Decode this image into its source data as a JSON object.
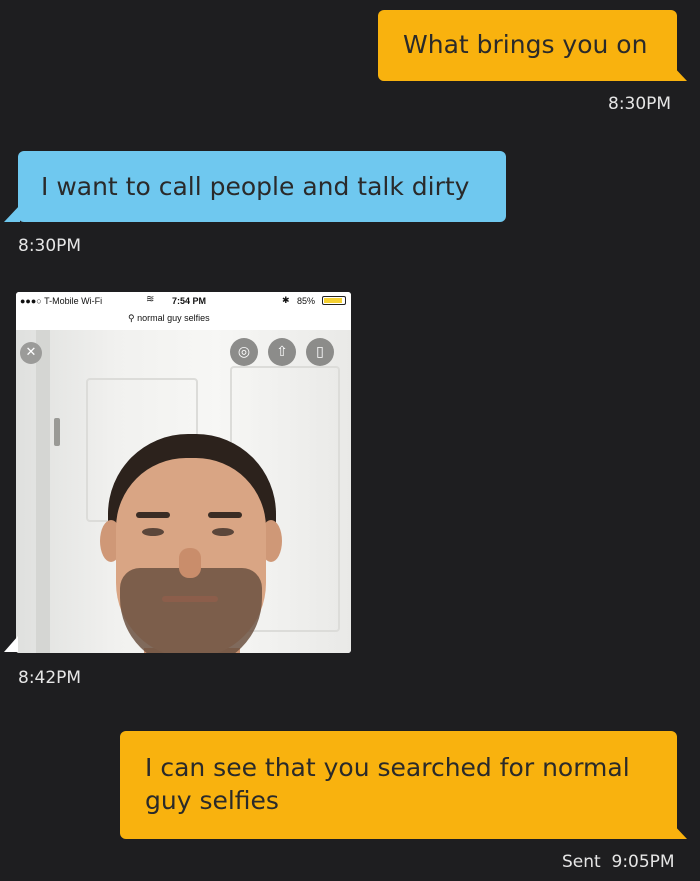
{
  "messages": [
    {
      "direction": "out",
      "text": "What brings you on",
      "time": "8:30PM"
    },
    {
      "direction": "in",
      "text": "I want to call people and talk dirty",
      "time": "8:30PM"
    },
    {
      "direction": "in",
      "type": "image",
      "time": "8:42PM",
      "screenshot": {
        "status": {
          "carrier": "T-Mobile Wi-Fi",
          "clock": "7:54 PM",
          "battery": "85%"
        },
        "search_query": "normal guy selfies",
        "buttons": [
          "lens-icon",
          "share-icon",
          "bookmark-icon"
        ],
        "close_icon": "close-icon"
      }
    },
    {
      "direction": "out",
      "text_line1": "I can see that you searched for normal",
      "text_line2": "guy selfies",
      "time": "Sent  9:05PM"
    }
  ],
  "colors": {
    "background": "#1e1e20",
    "outgoing": "#f9b20e",
    "incoming": "#6fc8ef"
  }
}
